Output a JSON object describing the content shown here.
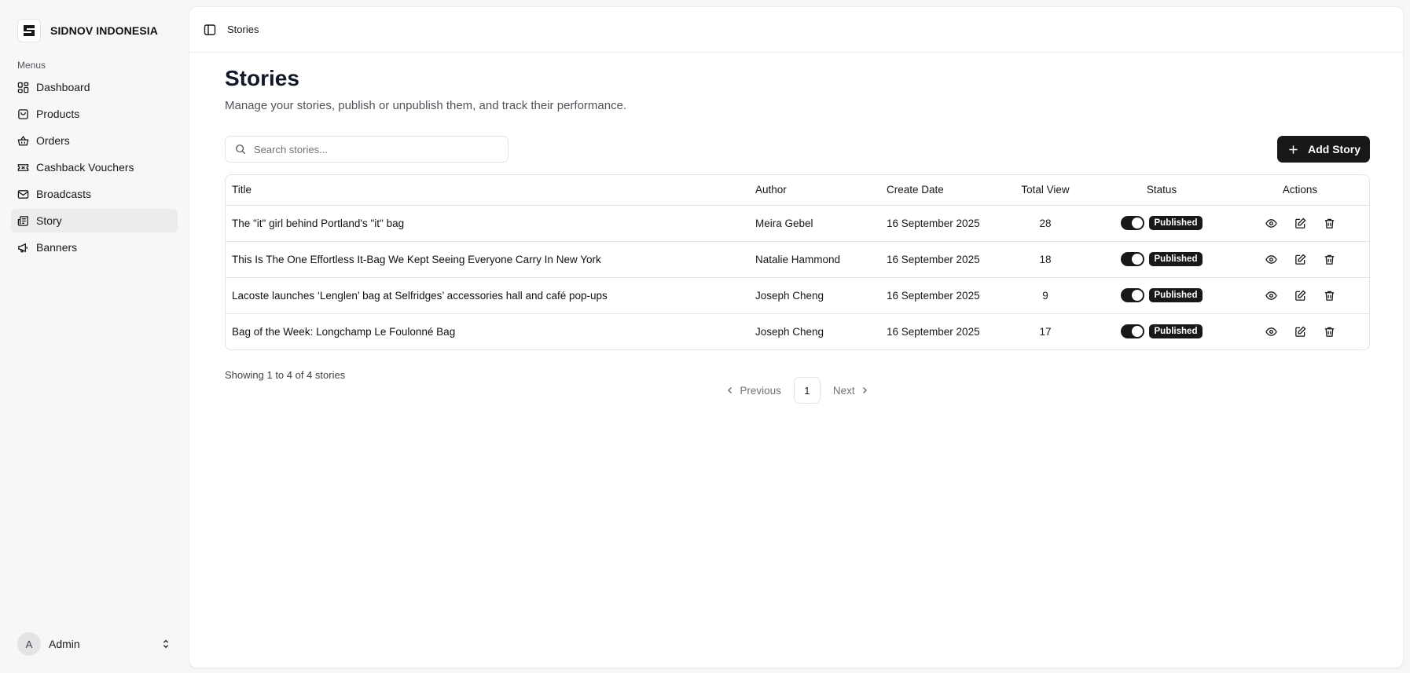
{
  "brand": {
    "name": "SIDNOV INDONESIA",
    "logo_icon": "sidnov-logo-icon"
  },
  "sidebar": {
    "section_label": "Menus",
    "items": [
      {
        "label": "Dashboard",
        "icon": "dashboard-icon"
      },
      {
        "label": "Products",
        "icon": "shopping-bag-icon"
      },
      {
        "label": "Orders",
        "icon": "basket-icon"
      },
      {
        "label": "Cashback Vouchers",
        "icon": "ticket-icon"
      },
      {
        "label": "Broadcasts",
        "icon": "mail-icon"
      },
      {
        "label": "Story",
        "icon": "newspaper-icon",
        "active": true
      },
      {
        "label": "Banners",
        "icon": "megaphone-icon"
      }
    ],
    "user": {
      "initial": "A",
      "name": "Admin"
    }
  },
  "topbar": {
    "breadcrumb": "Stories"
  },
  "page": {
    "title": "Stories",
    "subtitle": "Manage your stories, publish or unpublish them, and track their performance."
  },
  "search": {
    "placeholder": "Search stories...",
    "value": ""
  },
  "add_button": {
    "label": "Add Story"
  },
  "table": {
    "headers": {
      "title": "Title",
      "author": "Author",
      "date": "Create Date",
      "views": "Total View",
      "status": "Status",
      "actions": "Actions"
    },
    "rows": [
      {
        "title": "The \"it\" girl behind Portland's \"it\" bag",
        "author": "Meira Gebel",
        "date": "16 September 2025",
        "views": "28",
        "status": "Published",
        "published": true
      },
      {
        "title": "This Is The One Effortless It-Bag We Kept Seeing Everyone Carry In New York",
        "author": "Natalie Hammond",
        "date": "16 September 2025",
        "views": "18",
        "status": "Published",
        "published": true
      },
      {
        "title": "Lacoste launches ‘Lenglen’ bag at Selfridges’ accessories hall and café pop-ups",
        "author": "Joseph Cheng",
        "date": "16 September 2025",
        "views": "9",
        "status": "Published",
        "published": true
      },
      {
        "title": "Bag of the Week: Longchamp Le Foulonné Bag",
        "author": "Joseph Cheng",
        "date": "16 September 2025",
        "views": "17",
        "status": "Published",
        "published": true
      }
    ]
  },
  "footer": {
    "showing": "Showing 1 to 4 of 4 stories",
    "previous": "Previous",
    "next": "Next",
    "current_page": "1"
  },
  "colors": {
    "accent": "#18181b",
    "background": "#f7f7f8",
    "panel": "#ffffff",
    "border": "#e4e4e7"
  }
}
